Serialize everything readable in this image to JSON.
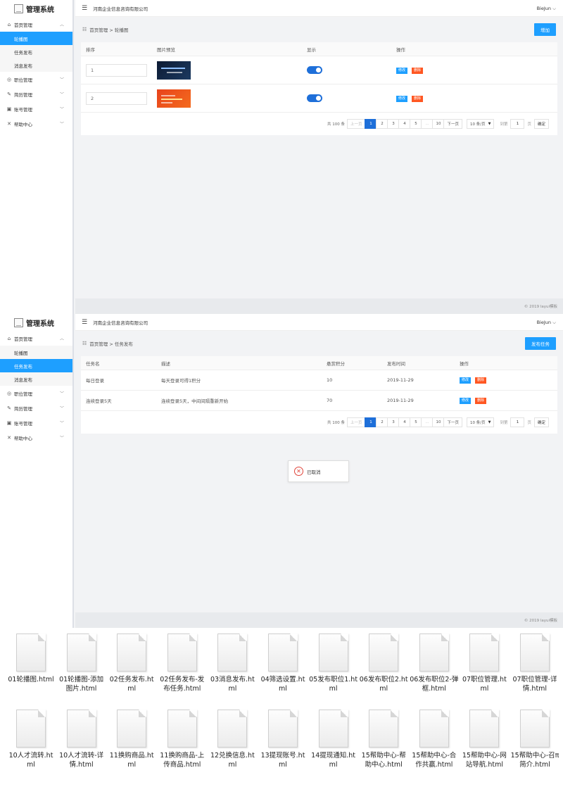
{
  "app": {
    "logo_text": "管理系统",
    "company": "河南企业信息咨询有限公司",
    "user": "BieJun ⌵",
    "footer": "© 2019 layui模板"
  },
  "sidebar": {
    "groups": [
      {
        "label": "首页管理",
        "icon": "home-icon"
      },
      {
        "label": "职位管理",
        "icon": "target-icon"
      },
      {
        "label": "简历管理",
        "icon": "edit-icon"
      },
      {
        "label": "账号管理",
        "icon": "account-icon"
      },
      {
        "label": "帮助中心",
        "icon": "help-icon"
      }
    ],
    "sub_items": [
      "轮播图",
      "任务发布",
      "消息发布"
    ]
  },
  "screen1": {
    "breadcrumb": "首页管理 > 轮播图",
    "action_button": "增加",
    "columns": [
      "排序",
      "图片预览",
      "显示",
      "操作"
    ],
    "rows": [
      {
        "sort": "1",
        "thumb_caption": "中国职业上海产业联盟会"
      },
      {
        "sort": "2",
        "thumb_caption": "优秀教育基地展示"
      }
    ]
  },
  "screen2": {
    "breadcrumb": "首页管理 > 任务发布",
    "action_button": "发布任务",
    "columns": [
      "任务名",
      "描述",
      "悬赏积分",
      "发布时间",
      "操作"
    ],
    "rows": [
      {
        "name": "每日登录",
        "desc": "每天登录可得1积分",
        "points": "10",
        "date": "2019-11-29"
      },
      {
        "name": "连续登录5天",
        "desc": "连续登录5天，中间间隔重新开始",
        "points": "70",
        "date": "2019-11-29"
      }
    ],
    "toast": "已取消"
  },
  "row_actions": {
    "edit": "修改",
    "delete": "删除"
  },
  "pagination": {
    "total": "共 100 条",
    "prev": "上一页",
    "pages": [
      "1",
      "2",
      "3",
      "4",
      "5",
      "...",
      "10"
    ],
    "next": "下一页",
    "page_size": "10 条/页",
    "goto": "到第",
    "goto_value": "1",
    "goto_suffix": "页",
    "confirm": "确定"
  },
  "files": [
    "01轮播图.html",
    "01轮播图-添加图片.html",
    "02任务发布.html",
    "02任务发布-发布任务.html",
    "03消息发布.html",
    "04筛选设置.html",
    "05发布职位1.html",
    "06发布职位2.html",
    "06发布职位2-弹框.html",
    "07职位管理.html",
    "07职位管理-详情.html",
    "10人才流转.html",
    "10人才流转-详情.html",
    "11换购商品.html",
    "11换购商品-上传商品.html",
    "12兑换信息.html",
    "13提现账号.html",
    "14提现通知.html",
    "15帮助中心-帮助中心.html",
    "15帮助中心-合作共赢.html",
    "15帮助中心-网站导航.html",
    "15帮助中心-召π简介.html"
  ]
}
